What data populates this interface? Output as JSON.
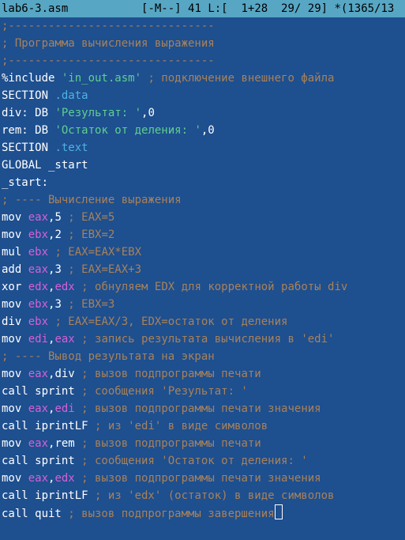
{
  "status_bar": {
    "filename": "lab6-3.asm",
    "mode": "[-M--]",
    "col": "41",
    "pos": "L:[  1+28  29/ 29]",
    "extra": "*(1365/13"
  },
  "lines": [
    [
      {
        "t": ";-------------------------------",
        "c": "cmt"
      }
    ],
    [
      {
        "t": "; Программа вычисления выражения",
        "c": "cmt"
      }
    ],
    [
      {
        "t": ";-------------------------------",
        "c": "cmt"
      }
    ],
    [
      {
        "t": "%include ",
        "c": "wht"
      },
      {
        "t": "'in_out.asm'",
        "c": "str"
      },
      {
        "t": " ; подключение внешнего файла",
        "c": "cmt"
      }
    ],
    [
      {
        "t": "SECTION ",
        "c": "wht"
      },
      {
        "t": ".data",
        "c": "sec"
      }
    ],
    [
      {
        "t": "div: DB ",
        "c": "wht"
      },
      {
        "t": "'Результат: '",
        "c": "str"
      },
      {
        "t": ",0",
        "c": "wht"
      }
    ],
    [
      {
        "t": "rem: DB ",
        "c": "wht"
      },
      {
        "t": "'Остаток от деления: '",
        "c": "str"
      },
      {
        "t": ",0",
        "c": "wht"
      }
    ],
    [
      {
        "t": "SECTION ",
        "c": "wht"
      },
      {
        "t": ".text",
        "c": "sec"
      }
    ],
    [
      {
        "t": "GLOBAL _start",
        "c": "wht"
      }
    ],
    [
      {
        "t": "_start:",
        "c": "wht"
      }
    ],
    [
      {
        "t": "; ---- Вычисление выражения",
        "c": "cmt"
      }
    ],
    [
      {
        "t": "mov ",
        "c": "wht"
      },
      {
        "t": "eax",
        "c": "reg"
      },
      {
        "t": ",5",
        "c": "wht"
      },
      {
        "t": " ; EAX=5",
        "c": "cmt"
      }
    ],
    [
      {
        "t": "mov ",
        "c": "wht"
      },
      {
        "t": "ebx",
        "c": "reg"
      },
      {
        "t": ",2",
        "c": "wht"
      },
      {
        "t": " ; EBX=2",
        "c": "cmt"
      }
    ],
    [
      {
        "t": "mul ",
        "c": "wht"
      },
      {
        "t": "ebx",
        "c": "reg"
      },
      {
        "t": " ; EAX=EAX*EBX",
        "c": "cmt"
      }
    ],
    [
      {
        "t": "add ",
        "c": "wht"
      },
      {
        "t": "eax",
        "c": "reg"
      },
      {
        "t": ",3",
        "c": "wht"
      },
      {
        "t": " ; EAX=EAX+3",
        "c": "cmt"
      }
    ],
    [
      {
        "t": "xor ",
        "c": "wht"
      },
      {
        "t": "edx",
        "c": "reg"
      },
      {
        "t": ",",
        "c": "wht"
      },
      {
        "t": "edx",
        "c": "reg"
      },
      {
        "t": " ; обнуляем EDX для корректной работы div",
        "c": "cmt"
      }
    ],
    [
      {
        "t": "mov ",
        "c": "wht"
      },
      {
        "t": "ebx",
        "c": "reg"
      },
      {
        "t": ",3",
        "c": "wht"
      },
      {
        "t": " ; EBX=3",
        "c": "cmt"
      }
    ],
    [
      {
        "t": "div ",
        "c": "wht"
      },
      {
        "t": "ebx",
        "c": "reg"
      },
      {
        "t": " ; EAX=EAX/3, EDX=остаток от деления",
        "c": "cmt"
      }
    ],
    [
      {
        "t": "mov ",
        "c": "wht"
      },
      {
        "t": "edi",
        "c": "reg"
      },
      {
        "t": ",",
        "c": "wht"
      },
      {
        "t": "eax",
        "c": "reg"
      },
      {
        "t": " ; запись результата вычисления в 'edi'",
        "c": "cmt"
      }
    ],
    [
      {
        "t": "; ---- Вывод результата на экран",
        "c": "cmt"
      }
    ],
    [
      {
        "t": "mov ",
        "c": "wht"
      },
      {
        "t": "eax",
        "c": "reg"
      },
      {
        "t": ",div",
        "c": "wht"
      },
      {
        "t": " ; вызов подпрограммы печати",
        "c": "cmt"
      }
    ],
    [
      {
        "t": "call sprint",
        "c": "wht"
      },
      {
        "t": " ; сообщения 'Результат: '",
        "c": "cmt"
      }
    ],
    [
      {
        "t": "mov ",
        "c": "wht"
      },
      {
        "t": "eax",
        "c": "reg"
      },
      {
        "t": ",",
        "c": "wht"
      },
      {
        "t": "edi",
        "c": "reg"
      },
      {
        "t": " ; вызов подпрограммы печати значения",
        "c": "cmt"
      }
    ],
    [
      {
        "t": "call iprintLF",
        "c": "wht"
      },
      {
        "t": " ; из 'edi' в виде символов",
        "c": "cmt"
      }
    ],
    [
      {
        "t": "mov ",
        "c": "wht"
      },
      {
        "t": "eax",
        "c": "reg"
      },
      {
        "t": ",rem",
        "c": "wht"
      },
      {
        "t": " ; вызов подпрограммы печати",
        "c": "cmt"
      }
    ],
    [
      {
        "t": "call sprint",
        "c": "wht"
      },
      {
        "t": " ; сообщения 'Остаток от деления: '",
        "c": "cmt"
      }
    ],
    [
      {
        "t": "mov ",
        "c": "wht"
      },
      {
        "t": "eax",
        "c": "reg"
      },
      {
        "t": ",",
        "c": "wht"
      },
      {
        "t": "edx",
        "c": "reg"
      },
      {
        "t": " ; вызов подпрограммы печати значения",
        "c": "cmt"
      }
    ],
    [
      {
        "t": "call iprintLF",
        "c": "wht"
      },
      {
        "t": " ; из 'edx' (остаток) в виде символов",
        "c": "cmt"
      }
    ],
    [
      {
        "t": "call quit",
        "c": "wht"
      },
      {
        "t": " ; вызов подпрограммы завершения",
        "c": "cmt"
      }
    ]
  ],
  "cursor_line": 28,
  "colors": {
    "background": "#1e4f8f",
    "status_bar": "#57a6c4",
    "comment": "#a8825a",
    "string": "#5ed08e",
    "register": "#d660d6",
    "section": "#4fb3e3",
    "text": "#ffffff"
  }
}
